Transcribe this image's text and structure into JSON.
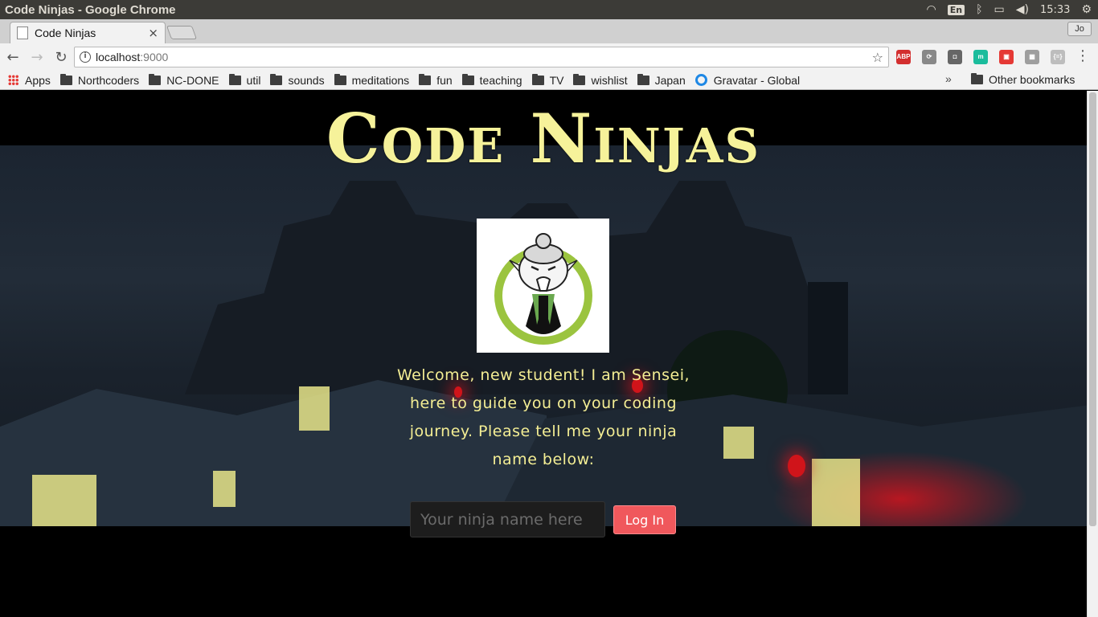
{
  "os": {
    "window_title": "Code Ninjas - Google Chrome",
    "lang": "En",
    "time": "15:33"
  },
  "browser": {
    "tab_title": "Code Ninjas",
    "tab_close": "×",
    "profile": "Jo",
    "url_host": "localhost",
    "url_port": ":9000",
    "extensions": [
      {
        "name": "adblock-plus-icon",
        "label": "ABP",
        "color": "#d32f2f"
      },
      {
        "name": "sync-extension-icon",
        "label": "⟳",
        "color": "#888888"
      },
      {
        "name": "ghost-extension-icon",
        "label": "◘",
        "color": "#666666"
      },
      {
        "name": "m-extension-icon",
        "label": "m",
        "color": "#1abc9c"
      },
      {
        "name": "flag-extension-icon",
        "label": "▣",
        "color": "#e53935"
      },
      {
        "name": "grid-extension-icon",
        "label": "▦",
        "color": "#9e9e9e"
      },
      {
        "name": "json-extension-icon",
        "label": "{=}",
        "color": "#bdbdbd"
      }
    ]
  },
  "bookmarks": {
    "apps": "Apps",
    "folders": [
      "Northcoders",
      "NC-DONE",
      "util",
      "sounds",
      "meditations",
      "fun",
      "teaching",
      "TV",
      "wishlist",
      "Japan"
    ],
    "gravatar": "Gravatar - Global",
    "more": "»",
    "other": "Other bookmarks"
  },
  "page": {
    "title": "Code Ninjas",
    "welcome": "Welcome, new student! I am Sensei, here to guide you on your coding journey. Please tell me your ninja name below:",
    "input_placeholder": "Your ninja name here",
    "input_value": "",
    "login_label": "Log In"
  },
  "colors": {
    "title": "#f6f29a",
    "welcome_text": "#f4ee94",
    "login_button": "#f0585c",
    "sensei_ring": "#9bc43f"
  }
}
